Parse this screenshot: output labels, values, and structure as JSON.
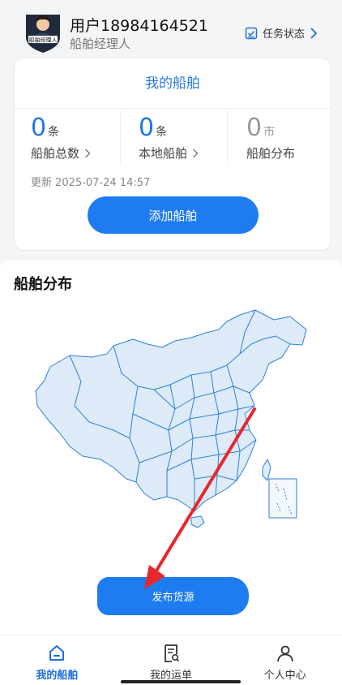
{
  "header": {
    "username": "用户18984164521",
    "role": "船舶经理人",
    "avatar_badge": "船舶经理人",
    "task_status": "任务状态"
  },
  "card": {
    "title": "我的船舶",
    "stats": [
      {
        "value": "0",
        "unit": "条",
        "label": "船舶总数"
      },
      {
        "value": "0",
        "unit": "条",
        "label": "本地船舶"
      },
      {
        "value": "0",
        "unit": "市",
        "label": "船舶分布"
      }
    ],
    "updated": "更新 2025-07-24 14:57",
    "add_button": "添加船舶"
  },
  "distribution": {
    "title": "船舶分布",
    "publish_button": "发布货源"
  },
  "nav": {
    "items": [
      {
        "label": "我的船舶",
        "icon": "home-icon",
        "active": true
      },
      {
        "label": "我的运单",
        "icon": "waybill-icon",
        "active": false
      },
      {
        "label": "个人中心",
        "icon": "person-icon",
        "active": false
      }
    ]
  },
  "colors": {
    "accent": "#1e7cf0",
    "map_fill": "#dcebf7",
    "map_stroke": "#2f7fd4",
    "arrow": "#e8262d"
  }
}
